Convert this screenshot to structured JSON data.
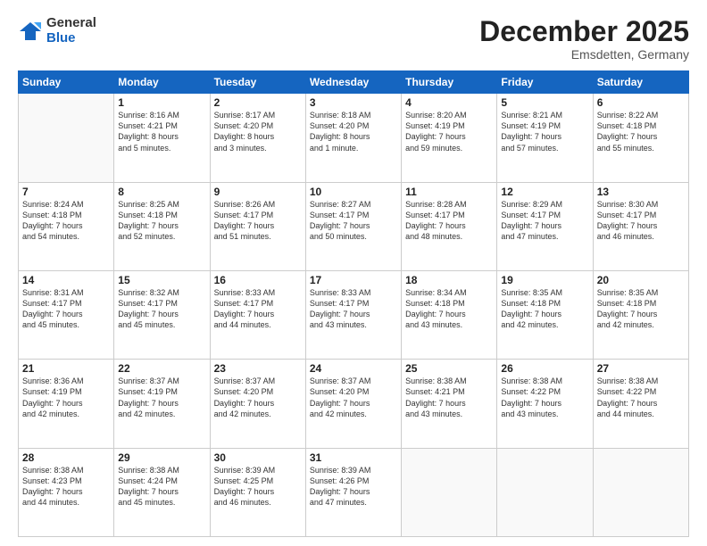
{
  "header": {
    "logo_general": "General",
    "logo_blue": "Blue",
    "month_title": "December 2025",
    "location": "Emsdetten, Germany"
  },
  "days_of_week": [
    "Sunday",
    "Monday",
    "Tuesday",
    "Wednesday",
    "Thursday",
    "Friday",
    "Saturday"
  ],
  "weeks": [
    [
      {
        "day": "",
        "info": ""
      },
      {
        "day": "1",
        "info": "Sunrise: 8:16 AM\nSunset: 4:21 PM\nDaylight: 8 hours\nand 5 minutes."
      },
      {
        "day": "2",
        "info": "Sunrise: 8:17 AM\nSunset: 4:20 PM\nDaylight: 8 hours\nand 3 minutes."
      },
      {
        "day": "3",
        "info": "Sunrise: 8:18 AM\nSunset: 4:20 PM\nDaylight: 8 hours\nand 1 minute."
      },
      {
        "day": "4",
        "info": "Sunrise: 8:20 AM\nSunset: 4:19 PM\nDaylight: 7 hours\nand 59 minutes."
      },
      {
        "day": "5",
        "info": "Sunrise: 8:21 AM\nSunset: 4:19 PM\nDaylight: 7 hours\nand 57 minutes."
      },
      {
        "day": "6",
        "info": "Sunrise: 8:22 AM\nSunset: 4:18 PM\nDaylight: 7 hours\nand 55 minutes."
      }
    ],
    [
      {
        "day": "7",
        "info": "Sunrise: 8:24 AM\nSunset: 4:18 PM\nDaylight: 7 hours\nand 54 minutes."
      },
      {
        "day": "8",
        "info": "Sunrise: 8:25 AM\nSunset: 4:18 PM\nDaylight: 7 hours\nand 52 minutes."
      },
      {
        "day": "9",
        "info": "Sunrise: 8:26 AM\nSunset: 4:17 PM\nDaylight: 7 hours\nand 51 minutes."
      },
      {
        "day": "10",
        "info": "Sunrise: 8:27 AM\nSunset: 4:17 PM\nDaylight: 7 hours\nand 50 minutes."
      },
      {
        "day": "11",
        "info": "Sunrise: 8:28 AM\nSunset: 4:17 PM\nDaylight: 7 hours\nand 48 minutes."
      },
      {
        "day": "12",
        "info": "Sunrise: 8:29 AM\nSunset: 4:17 PM\nDaylight: 7 hours\nand 47 minutes."
      },
      {
        "day": "13",
        "info": "Sunrise: 8:30 AM\nSunset: 4:17 PM\nDaylight: 7 hours\nand 46 minutes."
      }
    ],
    [
      {
        "day": "14",
        "info": "Sunrise: 8:31 AM\nSunset: 4:17 PM\nDaylight: 7 hours\nand 45 minutes."
      },
      {
        "day": "15",
        "info": "Sunrise: 8:32 AM\nSunset: 4:17 PM\nDaylight: 7 hours\nand 45 minutes."
      },
      {
        "day": "16",
        "info": "Sunrise: 8:33 AM\nSunset: 4:17 PM\nDaylight: 7 hours\nand 44 minutes."
      },
      {
        "day": "17",
        "info": "Sunrise: 8:33 AM\nSunset: 4:17 PM\nDaylight: 7 hours\nand 43 minutes."
      },
      {
        "day": "18",
        "info": "Sunrise: 8:34 AM\nSunset: 4:18 PM\nDaylight: 7 hours\nand 43 minutes."
      },
      {
        "day": "19",
        "info": "Sunrise: 8:35 AM\nSunset: 4:18 PM\nDaylight: 7 hours\nand 42 minutes."
      },
      {
        "day": "20",
        "info": "Sunrise: 8:35 AM\nSunset: 4:18 PM\nDaylight: 7 hours\nand 42 minutes."
      }
    ],
    [
      {
        "day": "21",
        "info": "Sunrise: 8:36 AM\nSunset: 4:19 PM\nDaylight: 7 hours\nand 42 minutes."
      },
      {
        "day": "22",
        "info": "Sunrise: 8:37 AM\nSunset: 4:19 PM\nDaylight: 7 hours\nand 42 minutes."
      },
      {
        "day": "23",
        "info": "Sunrise: 8:37 AM\nSunset: 4:20 PM\nDaylight: 7 hours\nand 42 minutes."
      },
      {
        "day": "24",
        "info": "Sunrise: 8:37 AM\nSunset: 4:20 PM\nDaylight: 7 hours\nand 42 minutes."
      },
      {
        "day": "25",
        "info": "Sunrise: 8:38 AM\nSunset: 4:21 PM\nDaylight: 7 hours\nand 43 minutes."
      },
      {
        "day": "26",
        "info": "Sunrise: 8:38 AM\nSunset: 4:22 PM\nDaylight: 7 hours\nand 43 minutes."
      },
      {
        "day": "27",
        "info": "Sunrise: 8:38 AM\nSunset: 4:22 PM\nDaylight: 7 hours\nand 44 minutes."
      }
    ],
    [
      {
        "day": "28",
        "info": "Sunrise: 8:38 AM\nSunset: 4:23 PM\nDaylight: 7 hours\nand 44 minutes."
      },
      {
        "day": "29",
        "info": "Sunrise: 8:38 AM\nSunset: 4:24 PM\nDaylight: 7 hours\nand 45 minutes."
      },
      {
        "day": "30",
        "info": "Sunrise: 8:39 AM\nSunset: 4:25 PM\nDaylight: 7 hours\nand 46 minutes."
      },
      {
        "day": "31",
        "info": "Sunrise: 8:39 AM\nSunset: 4:26 PM\nDaylight: 7 hours\nand 47 minutes."
      },
      {
        "day": "",
        "info": ""
      },
      {
        "day": "",
        "info": ""
      },
      {
        "day": "",
        "info": ""
      }
    ]
  ]
}
